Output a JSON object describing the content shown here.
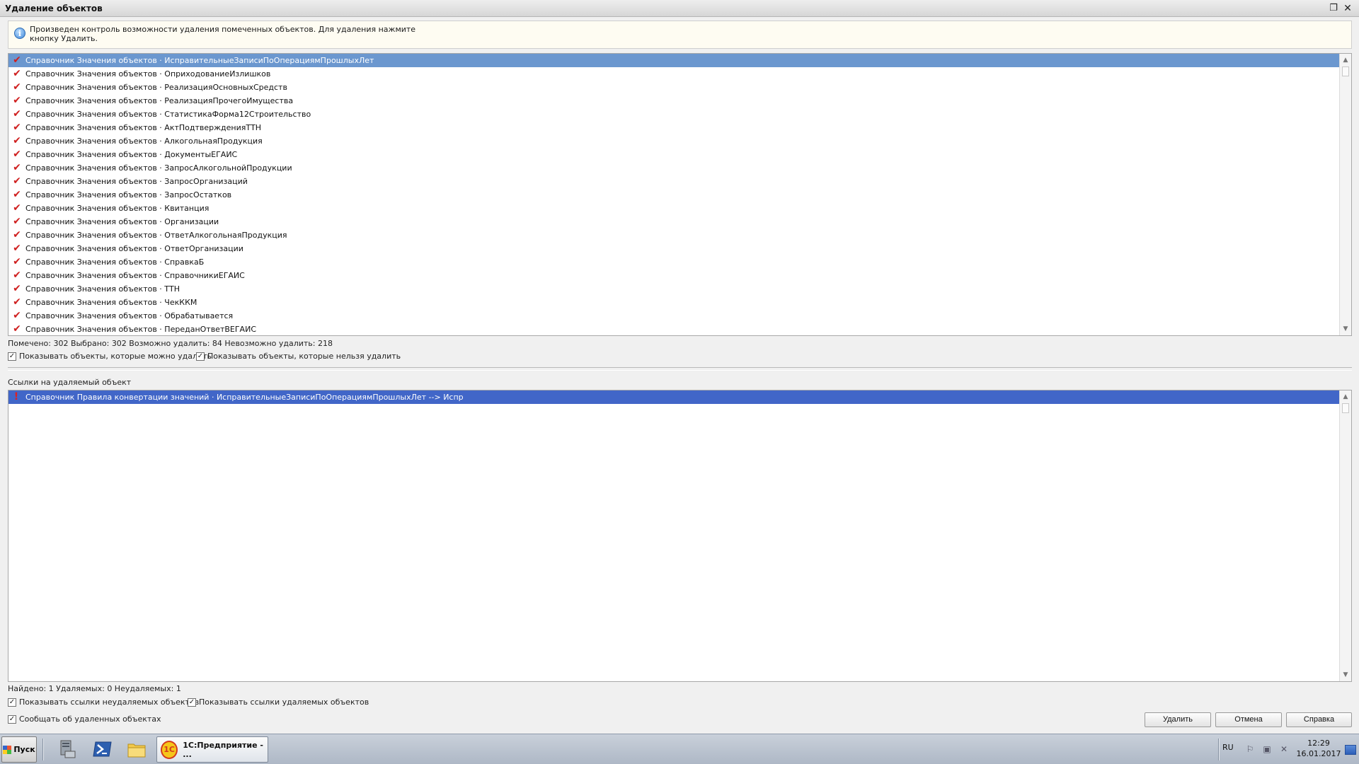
{
  "window": {
    "title": "Удаление объектов",
    "restore_icon": "restore-icon",
    "close_icon": "close-icon"
  },
  "info": {
    "icon": "info-icon",
    "text": "Произведен контроль возможности удаления помеченных объектов. Для удаления нажмите кнопку Удалить."
  },
  "objects": {
    "rows": [
      "Справочник Значения объектов · ИсправительныеЗаписиПоОперациямПрошлыхЛет",
      "Справочник Значения объектов · ОприходованиеИзлишков",
      "Справочник Значения объектов · РеализацияОсновныхСредств",
      "Справочник Значения объектов · РеализацияПрочегоИмущества",
      "Справочник Значения объектов · СтатистикаФорма12Строительство",
      "Справочник Значения объектов · АктПодтвержденияТТН",
      "Справочник Значения объектов · АлкогольнаяПродукция",
      "Справочник Значения объектов · ДокументыЕГАИС",
      "Справочник Значения объектов · ЗапросАлкогольнойПродукции",
      "Справочник Значения объектов · ЗапросОрганизаций",
      "Справочник Значения объектов · ЗапросОстатков",
      "Справочник Значения объектов · Квитанция",
      "Справочник Значения объектов · Организации",
      "Справочник Значения объектов · ОтветАлкогольнаяПродукция",
      "Справочник Значения объектов · ОтветОрганизации",
      "Справочник Значения объектов · СправкаБ",
      "Справочник Значения объектов · СправочникиЕГАИС",
      "Справочник Значения объектов · ТТН",
      "Справочник Значения объектов · ЧекККМ",
      "Справочник Значения объектов · Обрабатывается",
      "Справочник Значения объектов · ПереданОтветВЕГАИС"
    ],
    "status": "Помечено: 302  Выбрано: 302  Возможно удалить: 84  Невозможно удалить: 218",
    "show_deletable": "Показывать объекты, которые можно удалить",
    "show_undeletable": "Показывать объекты, которые нельзя удалить"
  },
  "references": {
    "label": "Ссылки на удаляемый объект",
    "rows": [
      "Справочник Правила конвертации значений · ИсправительныеЗаписиПоОперациямПрошлыхЛет --> Испр"
    ],
    "status": "Найдено: 1  Удаляемых: 0  Неудаляемых: 1",
    "show_undeletable_refs": "Показывать ссылки неудаляемых объектов",
    "show_deletable_refs": "Показывать ссылки удаляемых объектов"
  },
  "report_deleted": "Сообщать об удаленных объектах",
  "buttons": {
    "delete": "Удалить",
    "cancel": "Отмена",
    "help": "Справка"
  },
  "taskbar": {
    "start": "Пуск",
    "app_button": "1С:Предприятие - ...",
    "app_logo": "1С",
    "lang": "RU",
    "time": "12:29",
    "date": "16.01.2017"
  },
  "colors": {
    "selection": "#6b97cf",
    "ref_selection": "#4166c8",
    "check_mark": "#cf1f1f"
  }
}
